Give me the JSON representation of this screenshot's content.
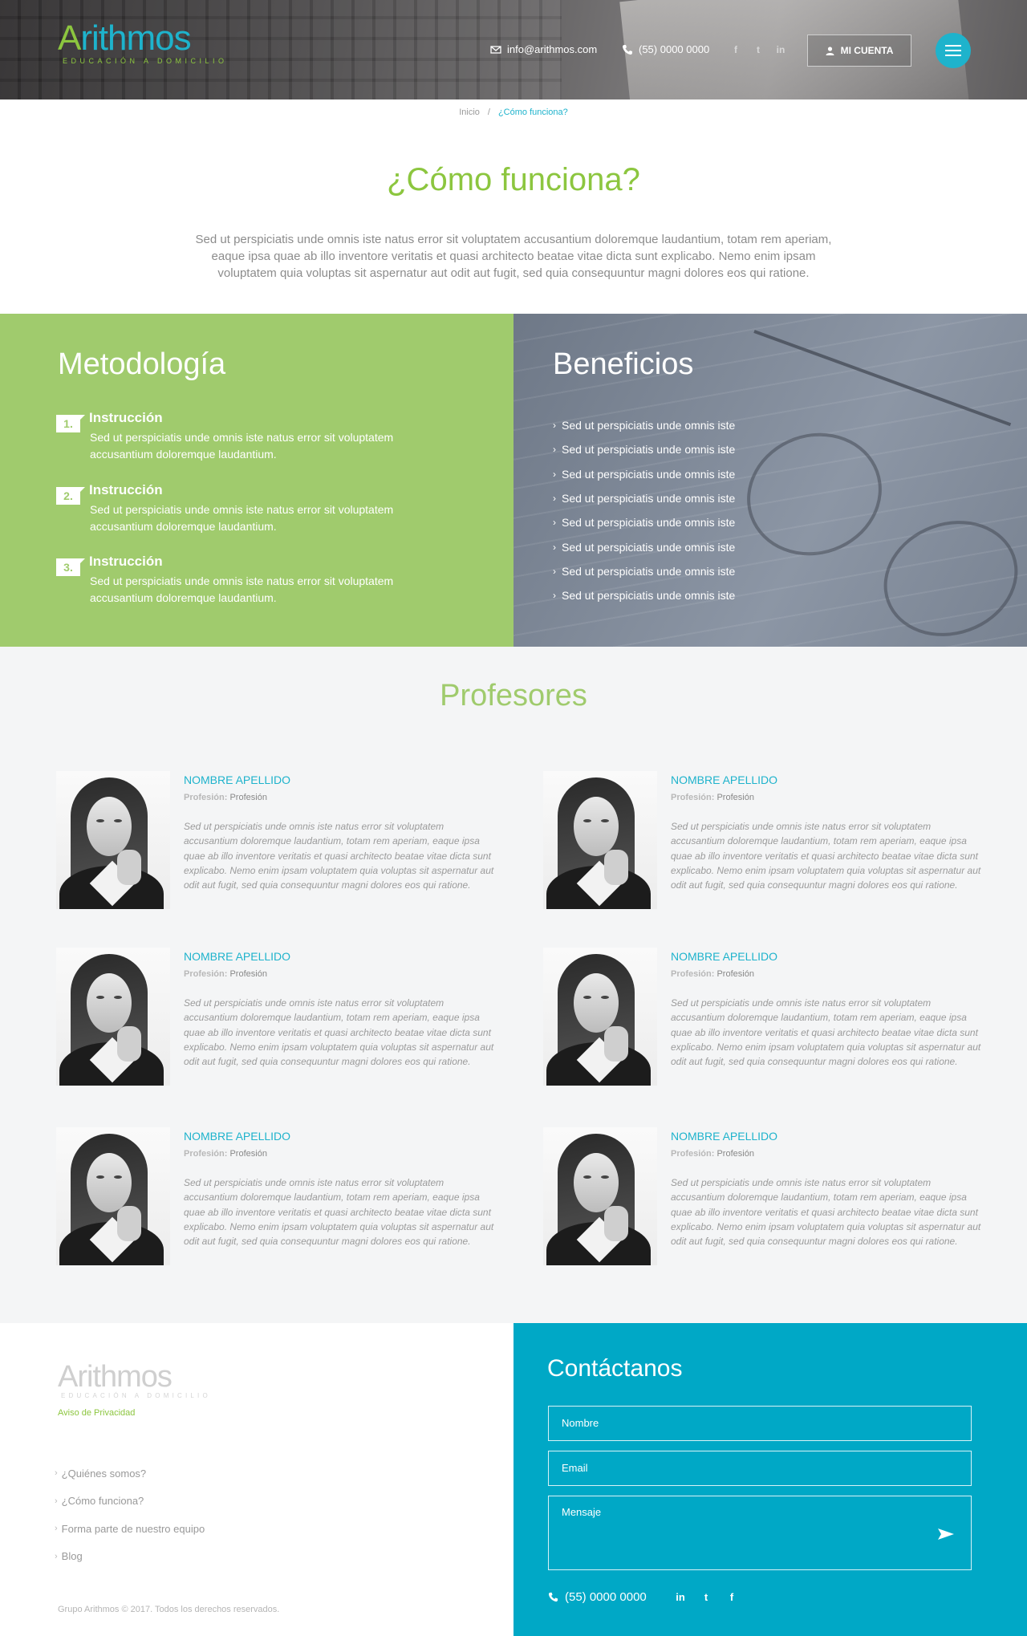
{
  "header": {
    "logo_initial": "A",
    "logo_rest": "rithmos",
    "logo_tagline": "EDUCACIÓN A DOMICILIO",
    "email": "info@arithmos.com",
    "phone": "(55) 0000 0000",
    "social": [
      {
        "icon": "facebook-icon",
        "glyph": "f"
      },
      {
        "icon": "twitter-icon",
        "glyph": "t"
      },
      {
        "icon": "linkedin-icon",
        "glyph": "in"
      }
    ],
    "account_label": "MI CUENTA",
    "colors": {
      "accent": "#1eb3cc",
      "brand_green": "#8cc63f"
    }
  },
  "breadcrumb": {
    "home": "Inicio",
    "separator": "/",
    "current": "¿Cómo funciona?"
  },
  "page_title": "¿Cómo funciona?",
  "intro": "Sed ut perspiciatis unde omnis iste natus error sit voluptatem accusantium doloremque laudantium, totam rem aperiam, eaque ipsa quae ab illo inventore veritatis et quasi architecto beatae vitae dicta sunt explicabo. Nemo enim ipsam voluptatem quia voluptas sit aspernatur aut odit aut fugit, sed quia consequuntur magni dolores eos qui ratione.",
  "methodology": {
    "title": "Metodología",
    "steps": [
      {
        "num": "1.",
        "title": "Instrucción",
        "text": "Sed ut perspiciatis unde omnis iste natus error sit voluptatem accusantium doloremque laudantium."
      },
      {
        "num": "2.",
        "title": "Instrucción",
        "text": "Sed ut perspiciatis unde omnis iste natus error sit voluptatem accusantium doloremque laudantium."
      },
      {
        "num": "3.",
        "title": "Instrucción",
        "text": "Sed ut perspiciatis unde omnis iste natus error sit voluptatem accusantium doloremque laudantium."
      }
    ]
  },
  "benefits": {
    "title": "Beneficios",
    "items": [
      "Sed ut perspiciatis unde omnis iste",
      "Sed ut perspiciatis unde omnis iste",
      "Sed ut perspiciatis unde omnis iste",
      "Sed ut perspiciatis unde omnis iste",
      "Sed ut perspiciatis unde omnis iste",
      "Sed ut perspiciatis unde omnis iste",
      "Sed ut perspiciatis unde omnis iste",
      "Sed ut perspiciatis unde omnis iste"
    ]
  },
  "professors": {
    "title": "Profesores",
    "items": [
      {
        "name": "NOMBRE APELLIDO",
        "role_label": "Profesión:",
        "role": "Profesión",
        "bio": "Sed ut perspiciatis unde omnis iste natus error sit voluptatem accusantium doloremque laudantium, totam rem aperiam, eaque ipsa quae ab illo inventore veritatis et quasi architecto beatae vitae dicta sunt explicabo. Nemo enim ipsam voluptatem quia voluptas sit aspernatur aut odit aut fugit, sed quia consequuntur magni dolores eos qui ratione."
      },
      {
        "name": "NOMBRE APELLIDO",
        "role_label": "Profesión:",
        "role": "Profesión",
        "bio": "Sed ut perspiciatis unde omnis iste natus error sit voluptatem accusantium doloremque laudantium, totam rem aperiam, eaque ipsa quae ab illo inventore veritatis et quasi architecto beatae vitae dicta sunt explicabo. Nemo enim ipsam voluptatem quia voluptas sit aspernatur aut odit aut fugit, sed quia consequuntur magni dolores eos qui ratione."
      },
      {
        "name": "NOMBRE APELLIDO",
        "role_label": "Profesión:",
        "role": "Profesión",
        "bio": "Sed ut perspiciatis unde omnis iste natus error sit voluptatem accusantium doloremque laudantium, totam rem aperiam, eaque ipsa quae ab illo inventore veritatis et quasi architecto beatae vitae dicta sunt explicabo. Nemo enim ipsam voluptatem quia voluptas sit aspernatur aut odit aut fugit, sed quia consequuntur magni dolores eos qui ratione."
      },
      {
        "name": "NOMBRE APELLIDO",
        "role_label": "Profesión:",
        "role": "Profesión",
        "bio": "Sed ut perspiciatis unde omnis iste natus error sit voluptatem accusantium doloremque laudantium, totam rem aperiam, eaque ipsa quae ab illo inventore veritatis et quasi architecto beatae vitae dicta sunt explicabo. Nemo enim ipsam voluptatem quia voluptas sit aspernatur aut odit aut fugit, sed quia consequuntur magni dolores eos qui ratione."
      },
      {
        "name": "NOMBRE APELLIDO",
        "role_label": "Profesión:",
        "role": "Profesión",
        "bio": "Sed ut perspiciatis unde omnis iste natus error sit voluptatem accusantium doloremque laudantium, totam rem aperiam, eaque ipsa quae ab illo inventore veritatis et quasi architecto beatae vitae dicta sunt explicabo. Nemo enim ipsam voluptatem quia voluptas sit aspernatur aut odit aut fugit, sed quia consequuntur magni dolores eos qui ratione."
      },
      {
        "name": "NOMBRE APELLIDO",
        "role_label": "Profesión:",
        "role": "Profesión",
        "bio": "Sed ut perspiciatis unde omnis iste natus error sit voluptatem accusantium doloremque laudantium, totam rem aperiam, eaque ipsa quae ab illo inventore veritatis et quasi architecto beatae vitae dicta sunt explicabo. Nemo enim ipsam voluptatem quia voluptas sit aspernatur aut odit aut fugit, sed quia consequuntur magni dolores eos qui ratione."
      }
    ]
  },
  "footer": {
    "logo_text": "Arithmos",
    "logo_tagline": "EDUCACIÓN A DOMICILIO",
    "privacy": "Aviso de Privacidad",
    "nav": [
      "¿Quiénes somos?",
      "¿Cómo funciona?",
      "Forma parte de nuestro equipo",
      "Blog"
    ],
    "copyright": "Grupo Arithmos © 2017. Todos los derechos reservados.",
    "contact": {
      "title": "Contáctanos",
      "name_placeholder": "Nombre",
      "email_placeholder": "Email",
      "message_placeholder": "Mensaje",
      "phone": "(55) 0000 0000",
      "social": [
        {
          "icon": "linkedin-icon",
          "glyph": "in"
        },
        {
          "icon": "twitter-icon",
          "glyph": "t"
        },
        {
          "icon": "facebook-icon",
          "glyph": "f"
        }
      ]
    },
    "colors": {
      "contact_bg": "#00a8c6"
    }
  }
}
